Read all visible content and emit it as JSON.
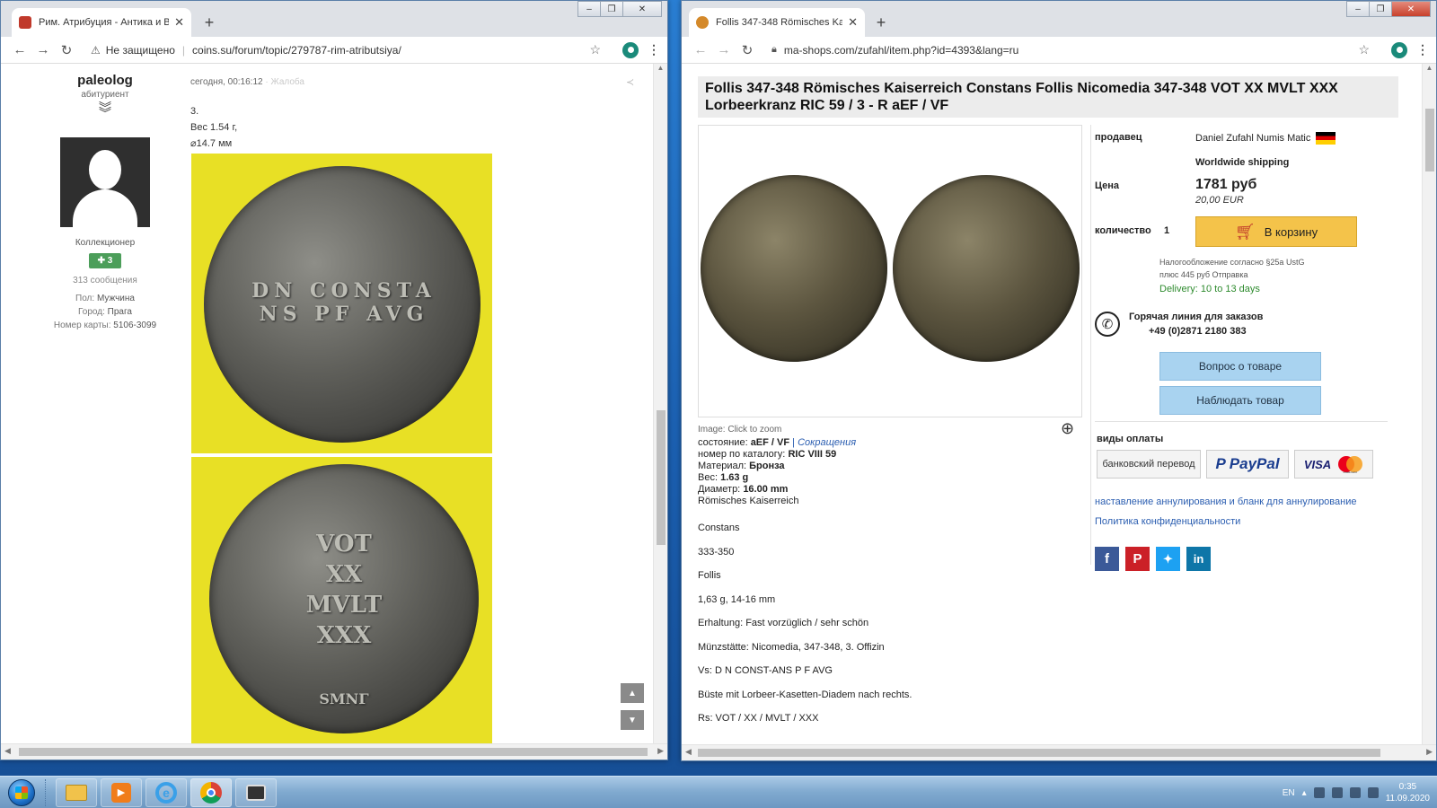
{
  "left_window": {
    "tab_title": "Рим. Атрибуция - Антика и Визант",
    "address_warning": "Не защищено",
    "url": "coins.su/forum/topic/279787-rim-atributsiya/"
  },
  "forum_post": {
    "username": "paleolog",
    "rank": "абитуриент",
    "group": "Коллекционер",
    "reputation": "3",
    "posts": "313 сообщения",
    "gender_label": "Пол:",
    "gender": "Мужчина",
    "city_label": "Город:",
    "city": "Прага",
    "card_label": "Номер карты:",
    "card": "5106-3099",
    "timestamp": "сегодня, 00:16:12",
    "report": "Жалоба",
    "line1": "3.",
    "line2": "Вес 1.54 г,",
    "line3": "⌀14.7 мм",
    "obverse_legend": "DN CONSTA NS PF AVG",
    "reverse_legend": "VOT XX MVLT XXX",
    "reverse_mint": "SMNΓ"
  },
  "right_window": {
    "tab_title": "Follis 347-348 Römisches Kaiserr",
    "url": "ma-shops.com/zufahl/item.php?id=4393&lang=ru"
  },
  "product": {
    "title": "Follis 347-348 Römisches Kaiserreich Constans Follis Nicomedia 347-348 VOT XX MVLT XXX Lorbeerkranz RIC 59 / 3 - R aEF / VF",
    "image_caption": "Image: Click to zoom",
    "condition_label": "состояние:",
    "condition": "aEF / VF",
    "abbreviations": "Сокращения",
    "catalog_label": "номер по каталогу:",
    "catalog": "RIC VIII 59",
    "material_label": "Материал:",
    "material": "Бронза",
    "weight_label": "Вес:",
    "weight": "1.63 g",
    "diameter_label": "Диаметр:",
    "diameter": "16.00 mm",
    "category": "Römisches Kaiserreich",
    "description": [
      "Constans",
      "333-350",
      "Follis",
      "1,63 g, 14-16 mm",
      "Erhaltung: Fast vorzüglich / sehr schön",
      "Münzstätte: Nicomedia, 347-348, 3. Offizin",
      "Vs: D N CONST-ANS P F AVG",
      "Büste mit Lorbeer-Kasetten-Diadem nach rechts.",
      "Rs: VOT / XX / MVLT / XXX"
    ]
  },
  "seller": {
    "seller_label": "продавец",
    "seller_name": "Daniel Zufahl Numis Matic",
    "shipping": "Worldwide shipping",
    "price_label": "Цена",
    "price": "1781 руб",
    "price_eur": "20,00 EUR",
    "quantity_label": "количество",
    "quantity": "1",
    "cart_button": "В корзину",
    "tax_note": "Налогообложение согласно §25a UstG",
    "shipping_note": "плюс 445 руб Отправка",
    "delivery": "Delivery: 10 to 13 days",
    "hotline_label": "Горячая линия для заказов",
    "hotline_phone": "+49 (0)2871 2180 383",
    "question_button": "Вопрос о товаре",
    "watch_button": "Наблюдать товар",
    "payment_label": "виды оплаты",
    "bank_transfer": "банковский перевод",
    "paypal": "PayPal",
    "visa": "VISA",
    "mastercard": "mastercard",
    "cancellation_link": "наставление аннулирования и бланк для аннулирование",
    "privacy_link": "Политика конфиденциальности"
  },
  "taskbar": {
    "lang": "EN",
    "time": "0:35",
    "date": "11.09.2020"
  },
  "colors": {
    "accent_link": "#2a5db0",
    "delivery_green": "#2e8b2e",
    "cart_yellow": "#f4c34a",
    "reputation_green": "#4c9e5a"
  }
}
